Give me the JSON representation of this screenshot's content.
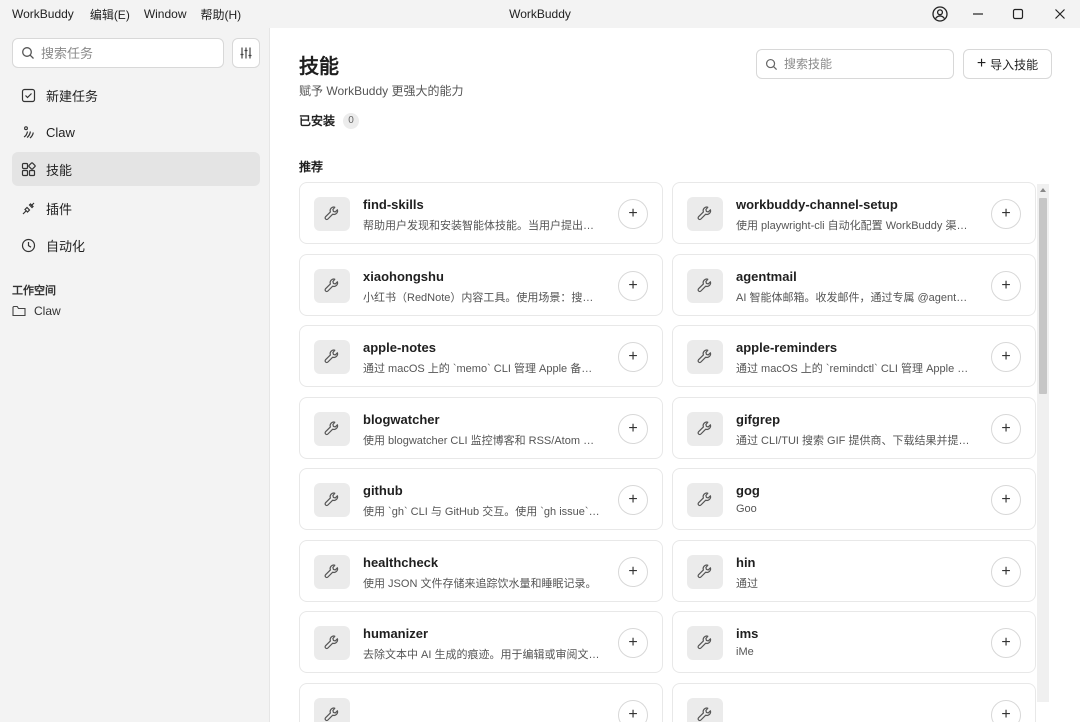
{
  "menubar": {
    "app": "WorkBuddy",
    "edit": "编辑(E)",
    "window": "Window",
    "help": "帮助(H)"
  },
  "window": {
    "title": "WorkBuddy",
    "icons": [
      "account-icon",
      "minimize-icon",
      "maximize-icon",
      "close-icon"
    ]
  },
  "sidebar": {
    "search_placeholder": "搜索任务",
    "items": [
      {
        "label": "新建任务",
        "icon": "new-task-icon"
      },
      {
        "label": "Claw",
        "icon": "claw-icon"
      },
      {
        "label": "技能",
        "icon": "skills-icon",
        "active": true
      },
      {
        "label": "插件",
        "icon": "plugin-icon"
      },
      {
        "label": "自动化",
        "icon": "clock-icon"
      }
    ],
    "workspace_title": "工作空间",
    "workspace_items": [
      {
        "label": "Claw",
        "icon": "folder-icon"
      }
    ]
  },
  "main": {
    "title": "技能",
    "subtitle": "赋予 WorkBuddy 更强大的能力",
    "search_placeholder": "搜索技能",
    "import_label": "导入技能",
    "installed_label": "已安装",
    "installed_count": "0",
    "recommend_label": "推荐",
    "skills": [
      {
        "name": "find-skills",
        "desc": "帮助用户发现和安装智能体技能。当用户提出「…"
      },
      {
        "name": "workbuddy-channel-setup",
        "desc": "使用 playwright-cli 自动化配置 WorkBuddy 渠道…"
      },
      {
        "name": "xiaohongshu",
        "desc": "小红书（RedNote）内容工具。使用场景：搜索…"
      },
      {
        "name": "agentmail",
        "desc": "AI 智能体邮箱。收发邮件，通过专属 @agentma…"
      },
      {
        "name": "apple-notes",
        "desc": "通过 macOS 上的 `memo` CLI 管理 Apple 备忘…"
      },
      {
        "name": "apple-reminders",
        "desc": "通过 macOS 上的 `remindctl` CLI 管理 Apple 提…"
      },
      {
        "name": "blogwatcher",
        "desc": "使用 blogwatcher CLI 监控博客和 RSS/Atom 订…"
      },
      {
        "name": "gifgrep",
        "desc": "通过 CLI/TUI 搜索 GIF 提供商、下载结果并提取…"
      },
      {
        "name": "github",
        "desc": "使用 `gh` CLI 与 GitHub 交互。使用 `gh issue`、`…"
      },
      {
        "name": "gog",
        "desc": "Goo"
      },
      {
        "name": "healthcheck",
        "desc": "使用 JSON 文件存储来追踪饮水量和睡眠记录。"
      },
      {
        "name": "hin",
        "desc": "通过"
      },
      {
        "name": "humanizer",
        "desc": "去除文本中 AI 生成的痕迹。用于编辑或审阅文本…"
      },
      {
        "name": "ims",
        "desc": "iMe"
      },
      {
        "name": "",
        "desc": ""
      },
      {
        "name": "",
        "desc": ""
      }
    ]
  }
}
